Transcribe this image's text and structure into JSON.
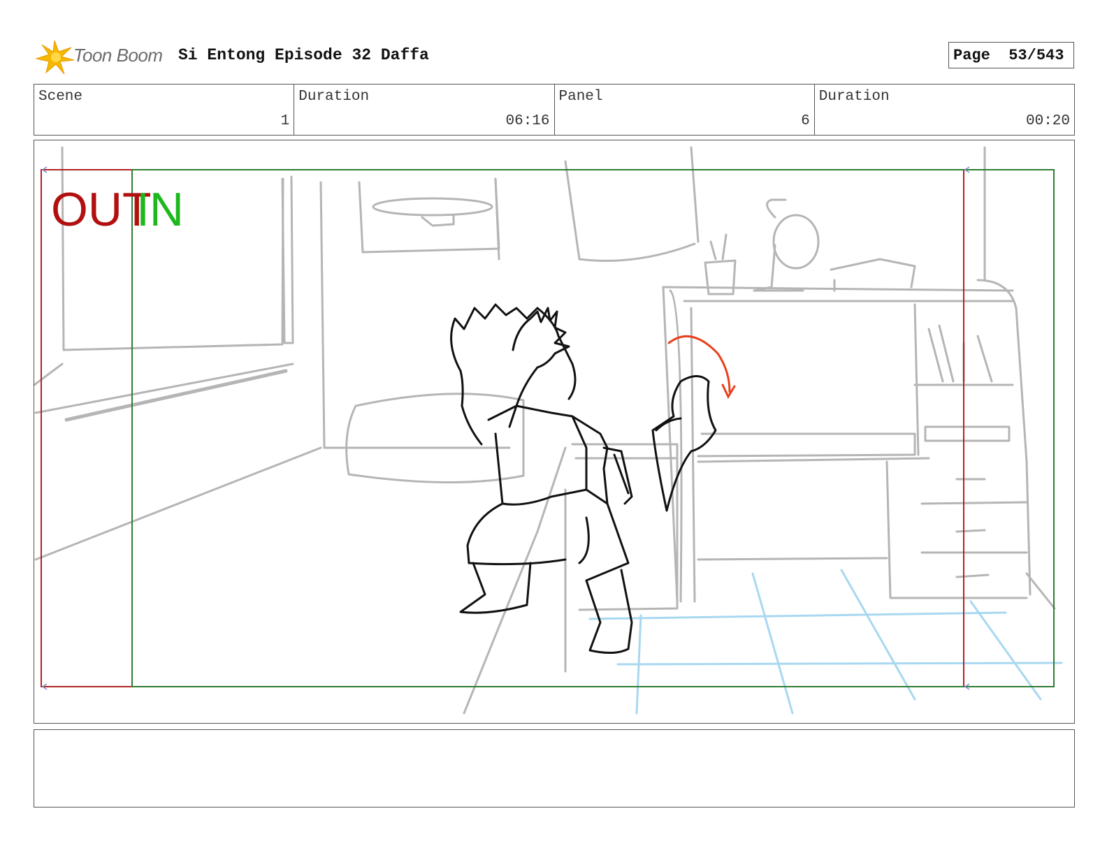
{
  "header": {
    "logo_text": "Toon Boom",
    "title": "Si Entong Episode 32 Daffa",
    "page_label": "Page",
    "page_value": "53/543"
  },
  "info": {
    "scene_label": "Scene",
    "scene_value": "1",
    "scene_duration_label": "Duration",
    "scene_duration_value": "06:16",
    "panel_label": "Panel",
    "panel_value": "6",
    "panel_duration_label": "Duration",
    "panel_duration_value": "00:20"
  },
  "panel": {
    "out_label": "OUT",
    "in_label": "IN",
    "colors": {
      "out_frame": "#b22222",
      "in_frame": "#2e7d32",
      "sketch_bg": "#b5b5b5",
      "character": "#111111",
      "floor": "#a8d8f0",
      "motion_arrow": "#e8401c"
    }
  },
  "notes": {
    "text": ""
  }
}
